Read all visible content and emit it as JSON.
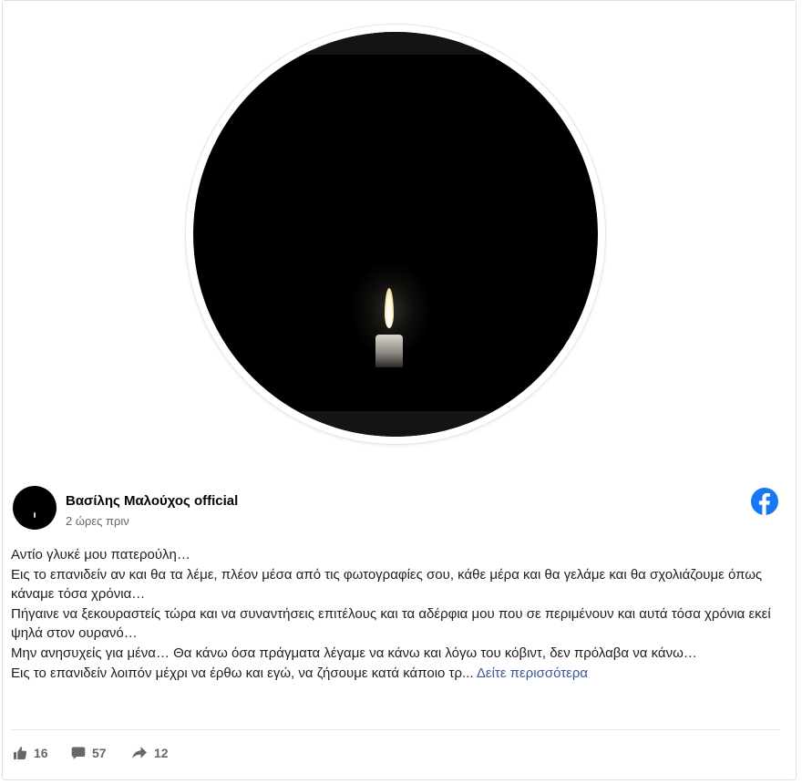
{
  "post": {
    "author_name": "Βασίλης Μαλούχος official",
    "timestamp": "2 ώρες πριν",
    "text_lines": [
      "Αντίο γλυκέ μου πατερούλη…",
      "Εις το επανιδείν αν και θα τα λέμε, πλέον μέσα από τις φωτογραφίες σου, κάθε μέρα και θα γελάμε και θα σχολιάζουμε όπως κάναμε τόσα χρόνια…",
      "Πήγαινε να ξεκουραστείς τώρα και να συναντήσεις επιτέλους και τα αδέρφια μου που σε περιμένουν και αυτά τόσα χρόνια εκεί ψηλά στον ουρανό…",
      "Μην ανησυχείς για μένα… Θα κάνω όσα πράγματα λέγαμε να κάνω και λόγω του κόβιντ, δεν πρόλαβα να κάνω…"
    ],
    "last_line": "Εις το επανιδείν λοιπόν μέχρι να έρθω και εγώ, να ζήσουμε κατά κάποιο τρ...",
    "see_more_label": "Δείτε περισσότερα"
  },
  "stats": {
    "likes": "16",
    "comments": "57",
    "shares": "12"
  },
  "icons": {
    "brand": "facebook-logo-icon",
    "like": "thumbs-up-icon",
    "comment": "comment-bubble-icon",
    "share": "share-arrow-icon"
  },
  "colors": {
    "facebook_blue": "#1877f2",
    "link": "#385898",
    "meta_text": "#65676b"
  }
}
